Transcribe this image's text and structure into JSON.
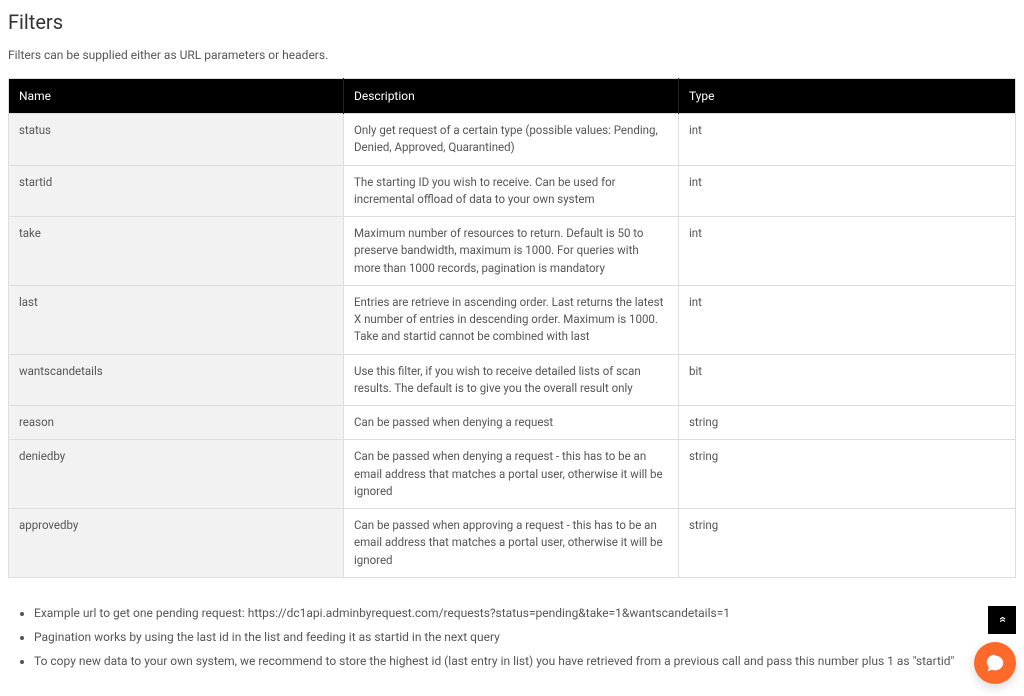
{
  "title": "Filters",
  "subtitle": "Filters can be supplied either as URL parameters or headers.",
  "table": {
    "headers": {
      "name": "Name",
      "description": "Description",
      "type": "Type"
    },
    "rows": [
      {
        "name": "status",
        "description": "Only get request of a certain type (possible values: Pending, Denied, Approved, Quarantined)",
        "type": "int"
      },
      {
        "name": "startid",
        "description": "The starting ID you wish to receive. Can be used for incremental offload of data to your own system",
        "type": "int"
      },
      {
        "name": "take",
        "description": "Maximum number of resources to return. Default is 50 to preserve bandwidth, maximum is 1000. For queries with more than 1000 records, pagination is mandatory",
        "type": "int"
      },
      {
        "name": "last",
        "description": "Entries are retrieve in ascending order. Last returns the latest X number of entries in descending order. Maximum is 1000. Take and startid cannot be combined with last",
        "type": "int"
      },
      {
        "name": "wantscandetails",
        "description": "Use this filter, if you wish to receive detailed lists of scan results. The default is to give you the overall result only",
        "type": "bit"
      },
      {
        "name": "reason",
        "description": "Can be passed when denying a request",
        "type": "string"
      },
      {
        "name": "deniedby",
        "description": "Can be passed when denying a request - this has to be an email address that matches a portal user, otherwise it will be ignored",
        "type": "string"
      },
      {
        "name": "approvedby",
        "description": "Can be passed when approving a request - this has to be an email address that matches a portal user, otherwise it will be ignored",
        "type": "string"
      }
    ]
  },
  "notes": [
    "Example url to get one pending request: https://dc1api.adminbyrequest.com/requests?status=pending&take=1&wantscandetails=1",
    "Pagination works by using the last id in the list and feeding it as startid in the next query",
    "To copy new data to your own system, we recommend to store the highest id (last entry in list) you have retrieved from a previous call and pass this number plus 1 as \"startid\""
  ]
}
